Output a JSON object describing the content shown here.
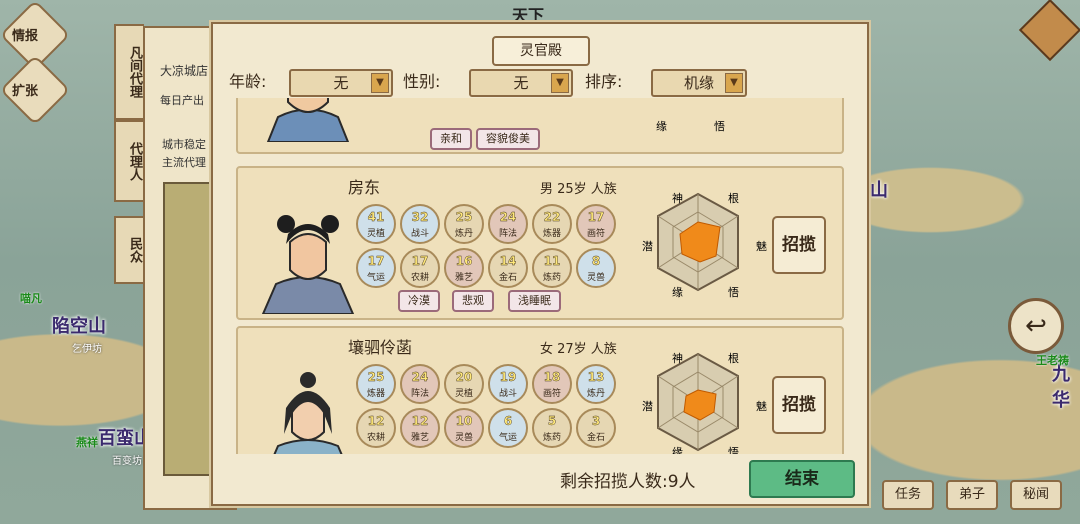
{
  "map": {
    "top_name": "天下",
    "labels": [
      {
        "text": "陷空山",
        "sub": "乞伊坊"
      },
      {
        "text": "百蛮山",
        "sub": "百变坊"
      },
      {
        "text": "九华",
        "sub": ""
      },
      {
        "text": "山",
        "sub": ""
      }
    ],
    "npcs": [
      "喵凡",
      "燕祥",
      "王老祷"
    ],
    "side_buttons": [
      "情报",
      "扩张"
    ],
    "bottom_buttons": [
      "任务",
      "弟子",
      "秘闻"
    ],
    "back_icon": "back-arrow-icon",
    "corner_icon": "diamond-menu-icon"
  },
  "under_panel": {
    "tabs": [
      "凡间代理",
      "代理人",
      "民众"
    ],
    "city_title": "大凉城店",
    "daily_output": "每日产出",
    "stability": "城市稳定",
    "main_agent": "主流代理"
  },
  "dialog": {
    "title": "灵官殿",
    "filters": [
      {
        "label": "年龄:",
        "value": "无"
      },
      {
        "label": "性别:",
        "value": "无"
      },
      {
        "label": "排序:",
        "value": "机缘"
      }
    ],
    "top_partial_card": {
      "traits": [
        "亲和",
        "容貌俊美"
      ],
      "hex_labels": [
        "缘",
        "悟"
      ]
    },
    "cards": [
      {
        "name": "房东",
        "info": "男 25岁 人族",
        "stats_row1": [
          {
            "v": "41",
            "l": "灵植"
          },
          {
            "v": "32",
            "l": "战斗"
          },
          {
            "v": "25",
            "l": "炼丹"
          },
          {
            "v": "24",
            "l": "阵法"
          },
          {
            "v": "22",
            "l": "炼器"
          },
          {
            "v": "17",
            "l": "画符"
          }
        ],
        "stats_row2": [
          {
            "v": "17",
            "l": "气运"
          },
          {
            "v": "17",
            "l": "农耕"
          },
          {
            "v": "16",
            "l": "雅艺"
          },
          {
            "v": "14",
            "l": "金石"
          },
          {
            "v": "11",
            "l": "炼药"
          },
          {
            "v": "8",
            "l": "灵兽"
          }
        ],
        "traits": [
          "冷漠",
          "悲观",
          "浅睡眠"
        ],
        "hex_labels": {
          "top_left": "神",
          "top_right": "根",
          "left": "潜",
          "right": "魅",
          "bottom_left": "缘",
          "bottom_right": "悟"
        },
        "recruit": "招揽"
      },
      {
        "name": "壤驷伶菡",
        "info": "女 27岁 人族",
        "stats_row1": [
          {
            "v": "25",
            "l": "炼器"
          },
          {
            "v": "24",
            "l": "阵法"
          },
          {
            "v": "20",
            "l": "灵植"
          },
          {
            "v": "19",
            "l": "战斗"
          },
          {
            "v": "18",
            "l": "画符"
          },
          {
            "v": "13",
            "l": "炼丹"
          }
        ],
        "stats_row2": [
          {
            "v": "12",
            "l": "农耕"
          },
          {
            "v": "12",
            "l": "雅艺"
          },
          {
            "v": "10",
            "l": "灵兽"
          },
          {
            "v": "6",
            "l": "气运"
          },
          {
            "v": "5",
            "l": "炼药"
          },
          {
            "v": "3",
            "l": "金石"
          }
        ],
        "traits": [],
        "hex_labels": {
          "top_left": "神",
          "top_right": "根",
          "left": "潜",
          "right": "魅",
          "bottom_left": "缘",
          "bottom_right": "悟"
        },
        "recruit": "招揽"
      }
    ],
    "footer": {
      "remaining": "剩余招揽人数:9人",
      "end": "结束"
    }
  }
}
